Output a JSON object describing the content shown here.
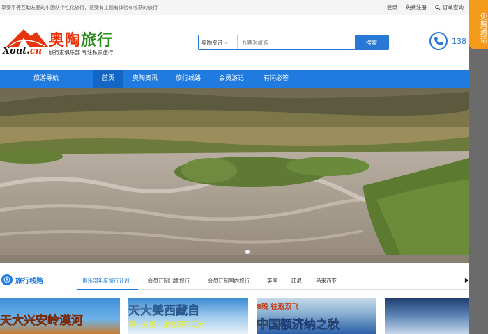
{
  "topbar": {
    "slogan": "享受平等互助友爱的小团队个性化旅行，感受有主题有体验有收获的旅行",
    "login": "登录",
    "register": "免费注册",
    "order_query": "订单查询"
  },
  "logo": {
    "brand_part1": "奥陶",
    "brand_part2": "旅行",
    "tagline": "旅行家俱乐部 专注私家旅行",
    "domain_a": "Xout.",
    "domain_b": "cn"
  },
  "search": {
    "category": "奥陶资讯",
    "placeholder": "九寨沟旅游",
    "button": "搜索"
  },
  "phone": {
    "number": "138"
  },
  "nav": {
    "guide": "旅游导航",
    "items": [
      "首页",
      "奥陶资讯",
      "旅行线路",
      "会员游记",
      "有问必答"
    ]
  },
  "section": {
    "title": "旅行线路",
    "tabs": [
      "俱乐部年度旅行计划",
      "会员订制出境旅行",
      "会员订制国内旅行",
      "英国",
      "印尼",
      "马来西亚"
    ]
  },
  "cards": [
    {
      "line1": "天大兴安岭漠河"
    },
    {
      "line1": "天大美西藏自",
      "line2": "察 · 墨脱 · 雅鲁藏布江大"
    },
    {
      "line1": "8晚  往返双飞",
      "line2": "中国额济纳之秋"
    },
    {
      "line1": ""
    }
  ],
  "sidebar": {
    "free_call": "免费通话"
  },
  "colors": {
    "primary": "#1f7be0",
    "accent": "#e8340d",
    "float": "#f39a1a"
  }
}
